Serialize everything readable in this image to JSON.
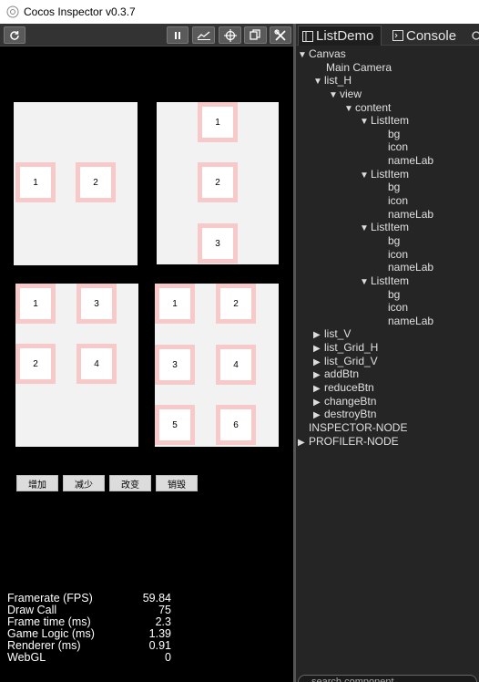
{
  "window": {
    "title": "Cocos Inspector v0.3.7"
  },
  "toolbar": {
    "refresh_icon": "refresh-icon",
    "pause_icon": "pause-icon",
    "chart_icon": "chart-icon",
    "target_icon": "target-icon",
    "copy_icon": "copy-icon",
    "tools_icon": "tools-icon"
  },
  "game": {
    "panel_top_left": {
      "items": [
        "1",
        "2"
      ]
    },
    "panel_top_right": {
      "items": [
        "1",
        "2",
        "3"
      ]
    },
    "panel_bottom_left": {
      "items": [
        "1",
        "3",
        "2",
        "4"
      ]
    },
    "panel_bottom_right": {
      "items": [
        "1",
        "2",
        "3",
        "4",
        "5",
        "6"
      ]
    },
    "buttons": [
      "增加",
      "减少",
      "改变",
      "销毁"
    ],
    "colors": {
      "cell_border": "#f8c9c9",
      "panel_bg": "#f2f2f2"
    }
  },
  "stats": [
    {
      "label": "Framerate (FPS)",
      "value": "59.84"
    },
    {
      "label": "Draw Call",
      "value": "75"
    },
    {
      "label": "Frame time (ms)",
      "value": "2.3"
    },
    {
      "label": "Game Logic (ms)",
      "value": "1.39"
    },
    {
      "label": "Renderer (ms)",
      "value": "0.91"
    },
    {
      "label": "WebGL",
      "value": "0"
    }
  ],
  "tabs": [
    {
      "label": "ListDemo",
      "icon": "tree-icon"
    },
    {
      "label": "Console",
      "icon": "console-icon"
    }
  ],
  "tree": [
    {
      "label": "Canvas",
      "depth": 0,
      "arrow": "down"
    },
    {
      "label": "Main Camera",
      "depth": 1,
      "arrow": "none"
    },
    {
      "label": "list_H",
      "depth": 1,
      "arrow": "down"
    },
    {
      "label": "view",
      "depth": 2,
      "arrow": "down"
    },
    {
      "label": "content",
      "depth": 3,
      "arrow": "down"
    },
    {
      "label": "ListItem",
      "depth": 4,
      "arrow": "down"
    },
    {
      "label": "bg",
      "depth": 5,
      "arrow": "none"
    },
    {
      "label": "icon",
      "depth": 5,
      "arrow": "none"
    },
    {
      "label": "nameLab",
      "depth": 5,
      "arrow": "none"
    },
    {
      "label": "ListItem",
      "depth": 4,
      "arrow": "down"
    },
    {
      "label": "bg",
      "depth": 5,
      "arrow": "none"
    },
    {
      "label": "icon",
      "depth": 5,
      "arrow": "none"
    },
    {
      "label": "nameLab",
      "depth": 5,
      "arrow": "none"
    },
    {
      "label": "ListItem",
      "depth": 4,
      "arrow": "down"
    },
    {
      "label": "bg",
      "depth": 5,
      "arrow": "none"
    },
    {
      "label": "icon",
      "depth": 5,
      "arrow": "none"
    },
    {
      "label": "nameLab",
      "depth": 5,
      "arrow": "none"
    },
    {
      "label": "ListItem",
      "depth": 4,
      "arrow": "down"
    },
    {
      "label": "bg",
      "depth": 5,
      "arrow": "none"
    },
    {
      "label": "icon",
      "depth": 5,
      "arrow": "none"
    },
    {
      "label": "nameLab",
      "depth": 5,
      "arrow": "none"
    },
    {
      "label": "list_V",
      "depth": 1,
      "arrow": "right"
    },
    {
      "label": "list_Grid_H",
      "depth": 1,
      "arrow": "right"
    },
    {
      "label": "list_Grid_V",
      "depth": 1,
      "arrow": "right"
    },
    {
      "label": "addBtn",
      "depth": 1,
      "arrow": "right"
    },
    {
      "label": "reduceBtn",
      "depth": 1,
      "arrow": "right"
    },
    {
      "label": "changeBtn",
      "depth": 1,
      "arrow": "right"
    },
    {
      "label": "destroyBtn",
      "depth": 1,
      "arrow": "right"
    },
    {
      "label": "INSPECTOR-NODE",
      "depth": 0,
      "arrow": "none"
    },
    {
      "label": "PROFILER-NODE",
      "depth": 0,
      "arrow": "right"
    }
  ],
  "search": {
    "placeholder": "search component"
  }
}
